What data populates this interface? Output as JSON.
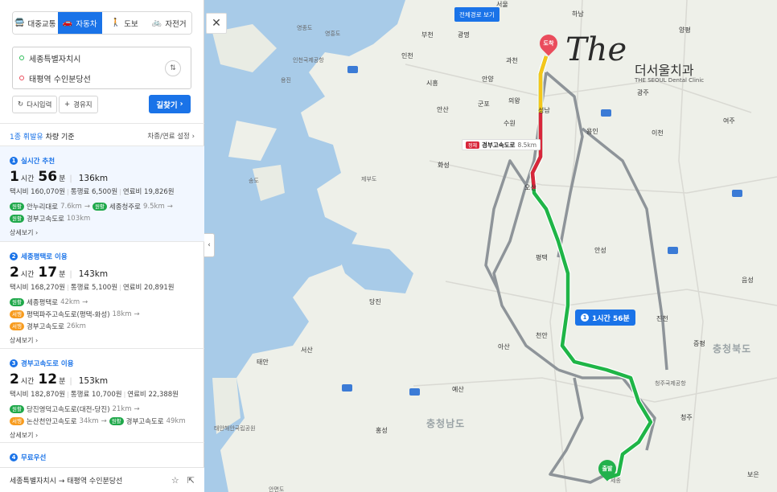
{
  "modes": [
    {
      "label": "대중교통",
      "icon": "bus-icon",
      "active": false
    },
    {
      "label": "자동차",
      "icon": "car-icon",
      "active": true
    },
    {
      "label": "도보",
      "icon": "walk-icon",
      "active": false
    },
    {
      "label": "자전거",
      "icon": "bike-icon",
      "active": false
    }
  ],
  "search": {
    "start": "세종특별자치시",
    "end": "태평역 수인분당선",
    "reset_label": "다시입력",
    "waypoint_label": "경유지",
    "route_label": "길찾기"
  },
  "vehicle": {
    "fuel_link": "1종 휘발유",
    "basis": "차량 기준",
    "settings": "차종/연료 설정"
  },
  "routes": [
    {
      "num": "1",
      "title": "실시간 추천",
      "hours": "1",
      "hours_unit": "시간",
      "minutes": "56",
      "minutes_unit": "분",
      "distance": "136km",
      "taxi": "택시비 160,070원",
      "toll": "통행료 6,500원",
      "fuel": "연료비 19,826원",
      "segments": [
        [
          {
            "tag": "원활",
            "tag_color": "green",
            "road": "안누리대로",
            "km": "7.6km"
          },
          {
            "tag": "원활",
            "tag_color": "green",
            "road": "세종청주로",
            "km": "9.5km"
          }
        ],
        [
          {
            "tag": "원활",
            "tag_color": "green",
            "road": "경부고속도로",
            "km": "103km"
          }
        ]
      ],
      "more": "상세보기"
    },
    {
      "num": "2",
      "title": "세종평택로 이용",
      "hours": "2",
      "hours_unit": "시간",
      "minutes": "17",
      "minutes_unit": "분",
      "distance": "143km",
      "taxi": "택시비 168,270원",
      "toll": "통행료 5,100원",
      "fuel": "연료비 20,891원",
      "segments": [
        [
          {
            "tag": "원활",
            "tag_color": "green",
            "road": "세종평택로",
            "km": "42km"
          }
        ],
        [
          {
            "tag": "서행",
            "tag_color": "orange",
            "road": "평택파주고속도로(평택-화성)",
            "km": "18km"
          }
        ],
        [
          {
            "tag": "서행",
            "tag_color": "orange",
            "road": "경부고속도로",
            "km": "26km"
          }
        ]
      ],
      "more": "상세보기"
    },
    {
      "num": "3",
      "title": "경부고속도로 이용",
      "hours": "2",
      "hours_unit": "시간",
      "minutes": "12",
      "minutes_unit": "분",
      "distance": "153km",
      "taxi": "택시비 182,870원",
      "toll": "통행료 10,700원",
      "fuel": "연료비 22,388원",
      "segments": [
        [
          {
            "tag": "원활",
            "tag_color": "green",
            "road": "당진영덕고속도로(대전-당진)",
            "km": "21km"
          }
        ],
        [
          {
            "tag": "서행",
            "tag_color": "orange",
            "road": "논산천안고속도로",
            "km": "34km"
          },
          {
            "tag": "원활",
            "tag_color": "green",
            "road": "경부고속도로",
            "km": "49km"
          }
        ]
      ],
      "more": "상세보기"
    },
    {
      "num": "4",
      "title": "무료우선"
    }
  ],
  "bottom": {
    "route_text": "세종특별자치시 → 태평역 수인분당선",
    "icons": [
      "star-icon",
      "share-icon"
    ]
  },
  "map": {
    "full_route_label": "전체경로 보기",
    "bubble_num": "1",
    "bubble_text": "1시간 56분",
    "congestion": {
      "tag": "정체",
      "road": "경부고속도로",
      "km": "8.5km"
    },
    "pin_end": "도착",
    "pin_start": "출발",
    "watermark": {
      "name": "더서울치과",
      "sub": "THE SEOUL Dental Clinic"
    },
    "labels": [
      "서울",
      "하남",
      "광명",
      "부천",
      "인천",
      "과천",
      "성남",
      "양평",
      "광주",
      "시흥",
      "안양",
      "안산",
      "군포",
      "의왕",
      "수원",
      "용인",
      "화성",
      "이천",
      "여주",
      "오산",
      "평택",
      "안성",
      "당진",
      "아산",
      "천안",
      "예산",
      "서산",
      "태안",
      "홍성",
      "청주",
      "증평",
      "충청북도",
      "충청남도",
      "음성",
      "진천",
      "보은",
      "영흥도",
      "용진",
      "제부도",
      "송도",
      "영종도",
      "세종",
      "안면도",
      "인천국제공항",
      "청주국제공항",
      "태안해안국립공원"
    ],
    "colors": {
      "water": "#a8cbe8",
      "land": "#eef0e9",
      "route_green": "#1fb547",
      "route_red": "#d8263b",
      "route_yellow": "#f5c61a",
      "alt_route": "#8e9499"
    }
  }
}
